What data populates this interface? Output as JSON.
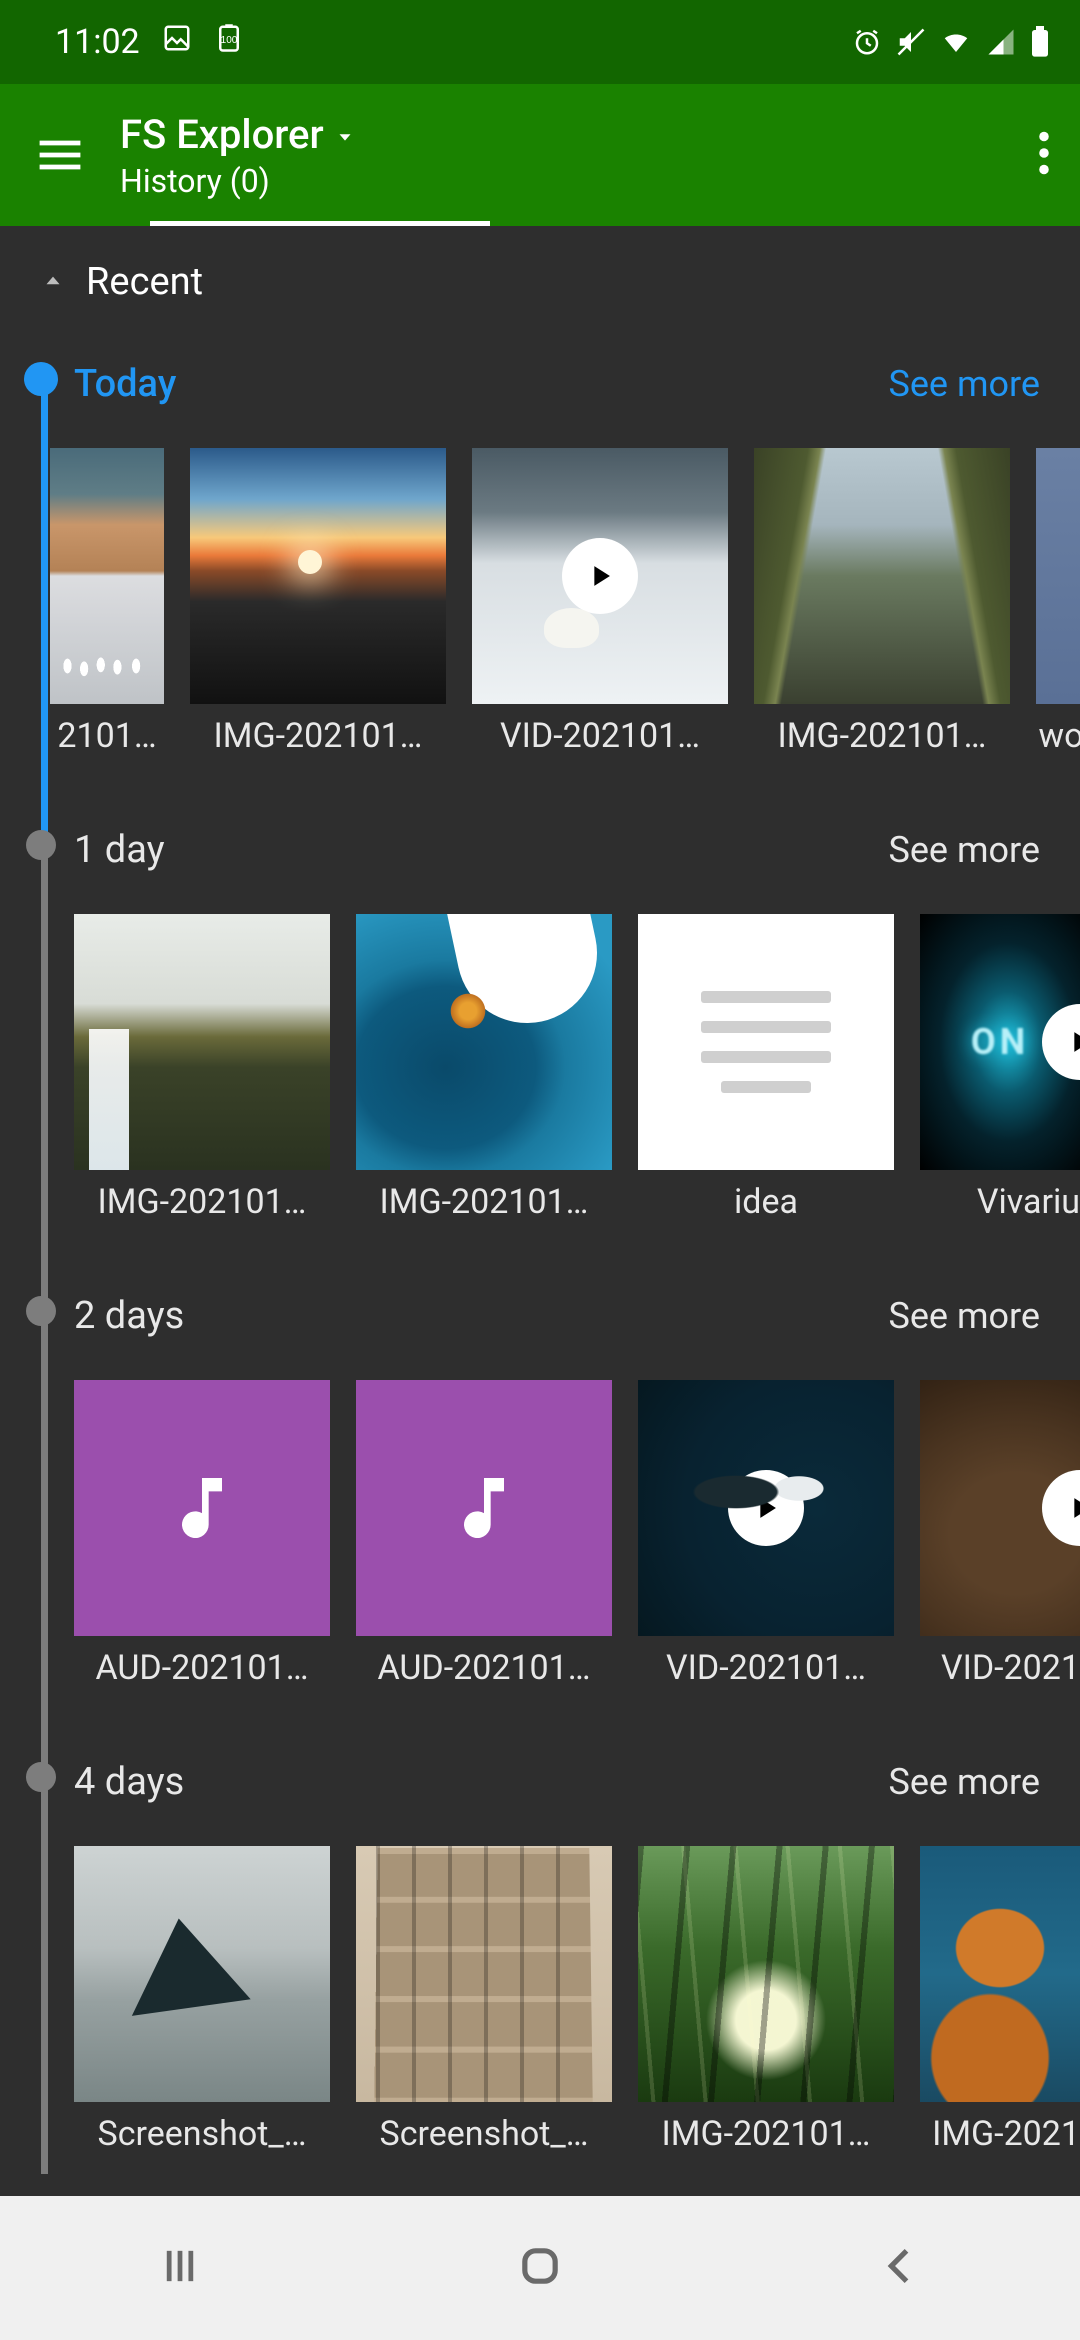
{
  "status": {
    "time": "11:02",
    "icons_left": [
      "image-icon",
      "battery-100-icon"
    ],
    "icons_right": [
      "alarm-icon",
      "mute-icon",
      "wifi-icon",
      "signal-icon",
      "battery-icon"
    ]
  },
  "appbar": {
    "title": "FS Explorer",
    "subtitle": "History (0)"
  },
  "recent_label": "Recent",
  "see_more_label": "See more",
  "sections": [
    {
      "key": "today",
      "label": "Today",
      "active": true,
      "items": [
        {
          "label": "2101…",
          "kind": "image"
        },
        {
          "label": "IMG-202101…",
          "kind": "image"
        },
        {
          "label": "VID-202101…",
          "kind": "video"
        },
        {
          "label": "IMG-202101…",
          "kind": "image"
        },
        {
          "label": "wo",
          "kind": "image"
        }
      ]
    },
    {
      "key": "1day",
      "label": "1 day",
      "active": false,
      "items": [
        {
          "label": "IMG-202101…",
          "kind": "image"
        },
        {
          "label": "IMG-202101…",
          "kind": "image"
        },
        {
          "label": "idea",
          "kind": "document"
        },
        {
          "label": "Vivariu",
          "kind": "video"
        }
      ]
    },
    {
      "key": "2days",
      "label": "2 days",
      "active": false,
      "items": [
        {
          "label": "AUD-202101…",
          "kind": "audio"
        },
        {
          "label": "AUD-202101…",
          "kind": "audio"
        },
        {
          "label": "VID-202101…",
          "kind": "video"
        },
        {
          "label": "VID-2021",
          "kind": "video"
        }
      ]
    },
    {
      "key": "4days",
      "label": "4 days",
      "active": false,
      "items": [
        {
          "label": "Screenshot_…",
          "kind": "image"
        },
        {
          "label": "Screenshot_…",
          "kind": "image"
        },
        {
          "label": "IMG-202101…",
          "kind": "image"
        },
        {
          "label": "IMG-2021",
          "kind": "image"
        }
      ]
    }
  ]
}
